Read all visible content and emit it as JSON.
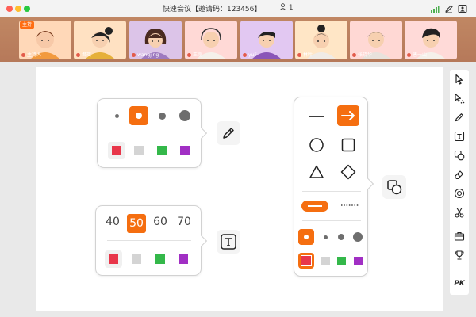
{
  "window": {
    "title": "快速会议【邀请码：123456】",
    "participant_count": "1"
  },
  "participants": [
    {
      "name": "主持人",
      "host_badge": "主持",
      "bg": "#ffd8b8"
    },
    {
      "name": "君瑶",
      "bg": "#ffe1c2"
    },
    {
      "name": "wangjing",
      "bg": "#dcc4e8"
    },
    {
      "name": "王刚",
      "bg": "#ffd9d6"
    },
    {
      "name": "yuli",
      "bg": "#e2c8f2"
    },
    {
      "name": "林叶",
      "bg": "#ffe6c6"
    },
    {
      "name": "张晓华",
      "bg": "#ffd8d4"
    },
    {
      "name": "唐一山",
      "bg": "#ffdad8"
    }
  ],
  "pen_panel": {
    "colors": [
      "#e8364a",
      "#d4d4d4",
      "#34b84a",
      "#a12fc4"
    ]
  },
  "text_panel": {
    "sizes": [
      "40",
      "50",
      "60",
      "70"
    ],
    "selected_size": "50",
    "colors": [
      "#e8364a",
      "#d4d4d4",
      "#34b84a",
      "#a12fc4"
    ]
  },
  "shape_panel": {
    "colors": [
      "#e8364a",
      "#d4d4d4",
      "#34b84a",
      "#a12fc4"
    ]
  },
  "sidebar": {
    "tools": [
      "cursor-icon",
      "laser-pointer-icon",
      "pen-icon",
      "text-icon",
      "shape-icon",
      "eraser-icon",
      "target-icon",
      "scissors-icon",
      "toolbox-icon",
      "trophy-icon",
      "pk"
    ],
    "pk_label": "PK"
  },
  "colors": {
    "accent": "#f56e10"
  }
}
